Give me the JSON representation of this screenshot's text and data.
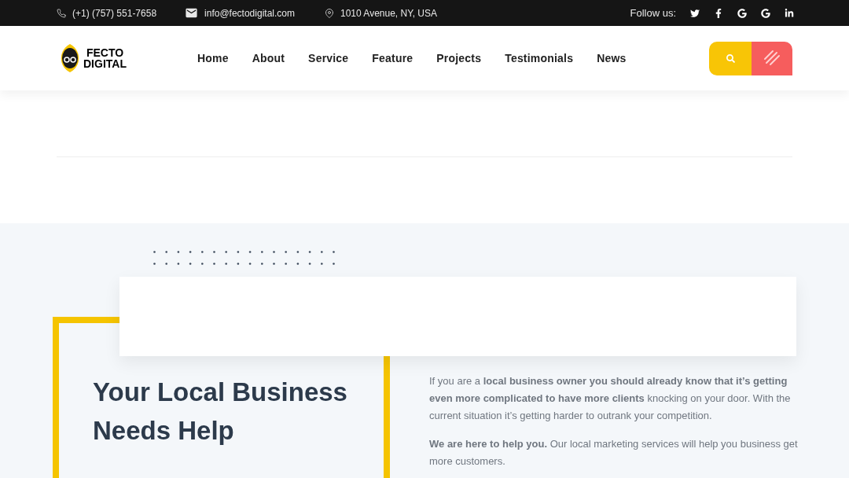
{
  "topbar": {
    "phone": "(+1) (757) 551-7658",
    "email": "info@fectodigital.com",
    "address": "1010 Avenue, NY, USA",
    "follow_label": "Follow us:",
    "socials": [
      {
        "kind": "twitter"
      },
      {
        "kind": "facebook"
      },
      {
        "kind": "google"
      },
      {
        "kind": "google"
      },
      {
        "kind": "linkedin"
      }
    ]
  },
  "logo": {
    "lines": [
      "FECTO",
      "DIGITAL"
    ]
  },
  "nav": [
    {
      "label": "Home"
    },
    {
      "label": "About"
    },
    {
      "label": "Service"
    },
    {
      "label": "Feature"
    },
    {
      "label": "Projects"
    },
    {
      "label": "Testimonials"
    },
    {
      "label": "News"
    }
  ],
  "about": {
    "heading": "Your Local Business Needs Help",
    "paragraphs": [
      "If you are a **local business owner you should already know that it’s getting even more complicated to have more clients** knocking on your door. With the current situation it’s getting harder to outrank your competition.",
      "**We are here to help you.** Our local marketing services will help you business get more customers."
    ]
  }
}
